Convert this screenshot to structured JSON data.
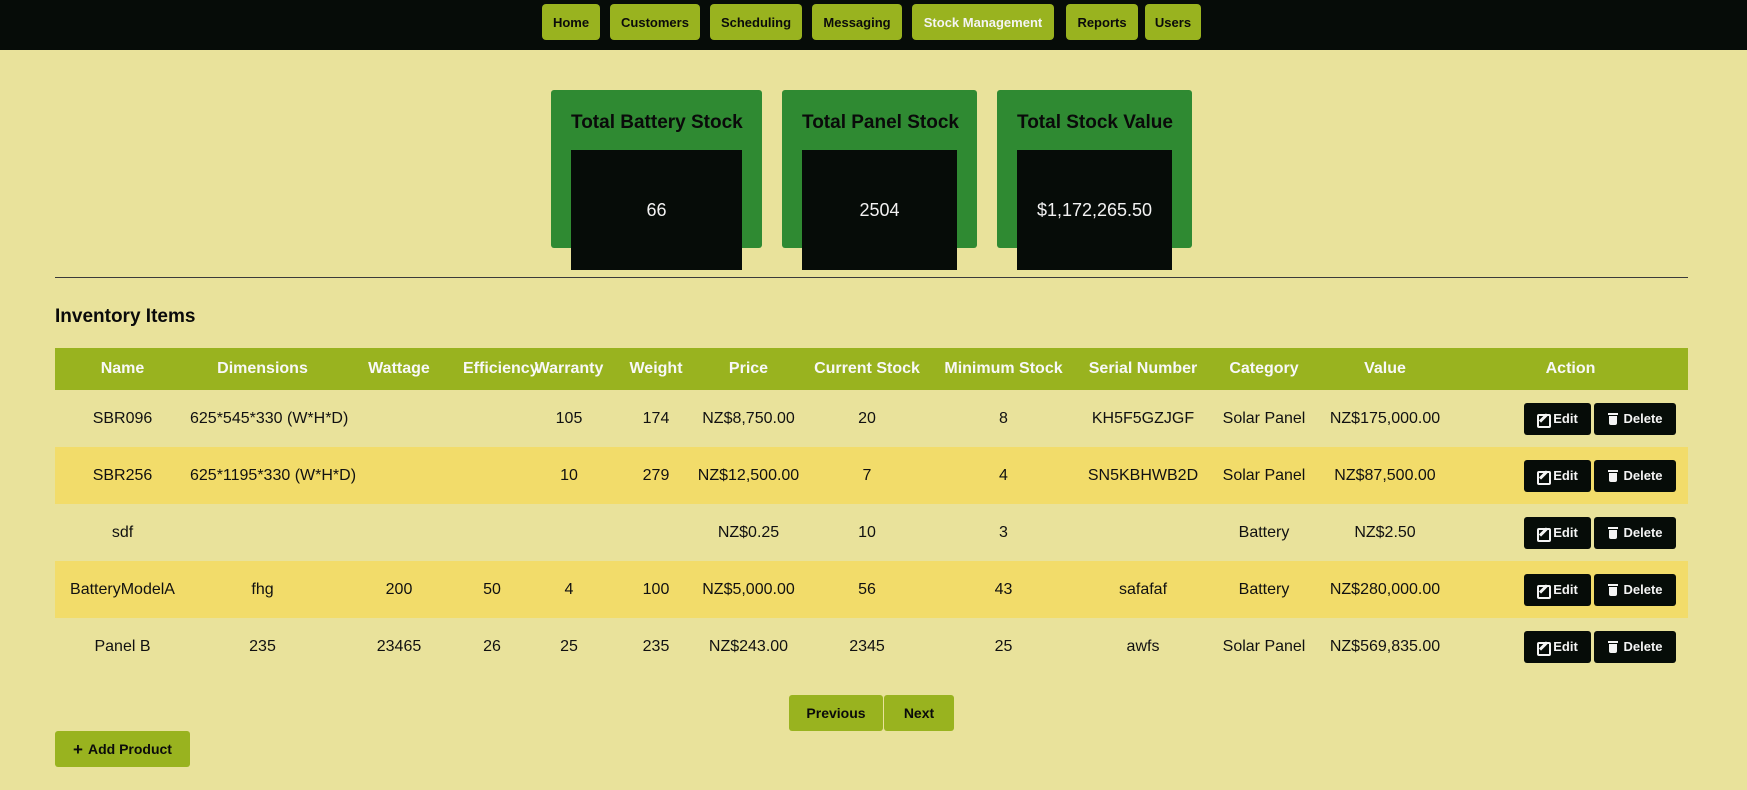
{
  "nav": {
    "items": [
      {
        "label": "Home"
      },
      {
        "label": "Customers"
      },
      {
        "label": "Scheduling"
      },
      {
        "label": "Messaging"
      },
      {
        "label": "Stock Management"
      },
      {
        "label": "Reports"
      },
      {
        "label": "Users"
      }
    ],
    "active": "Stock Management"
  },
  "summary": {
    "battery": {
      "title": "Total Battery Stock",
      "value": "66"
    },
    "panel": {
      "title": "Total Panel Stock",
      "value": "2504"
    },
    "value": {
      "title": "Total Stock Value",
      "value": "$1,172,265.50"
    }
  },
  "inventory": {
    "title": "Inventory Items",
    "columns": [
      "Name",
      "Dimensions",
      "Wattage",
      "Efficiency",
      "Warranty",
      "Weight",
      "Price",
      "Current Stock",
      "Minimum Stock",
      "Serial Number",
      "Category",
      "Value",
      "Action"
    ],
    "rows": [
      [
        "SBR096",
        "625*545*330 (W*H*D)",
        "",
        "",
        "105",
        "174",
        "NZ$8,750.00",
        "20",
        "8",
        "KH5F5GZJGF",
        "Solar Panel",
        "NZ$175,000.00"
      ],
      [
        "SBR256",
        "625*1195*330 (W*H*D)",
        "",
        "",
        "10",
        "279",
        "NZ$12,500.00",
        "7",
        "4",
        "SN5KBHWB2D",
        "Solar Panel",
        "NZ$87,500.00"
      ],
      [
        "sdf",
        "",
        "",
        "",
        "",
        "",
        "NZ$0.25",
        "10",
        "3",
        "",
        "Battery",
        "NZ$2.50"
      ],
      [
        "BatteryModelA",
        "fhg",
        "200",
        "50",
        "4",
        "100",
        "NZ$5,000.00",
        "56",
        "43",
        "safafaf",
        "Battery",
        "NZ$280,000.00"
      ],
      [
        "Panel B",
        "235",
        "23465",
        "26",
        "25",
        "235",
        "NZ$243.00",
        "2345",
        "25",
        "awfs",
        "Solar Panel",
        "NZ$569,835.00"
      ]
    ],
    "edit_label": "Edit",
    "delete_label": "Delete"
  },
  "pagination": {
    "previous": "Previous",
    "next": "Next"
  },
  "add_product_label": "Add Product"
}
